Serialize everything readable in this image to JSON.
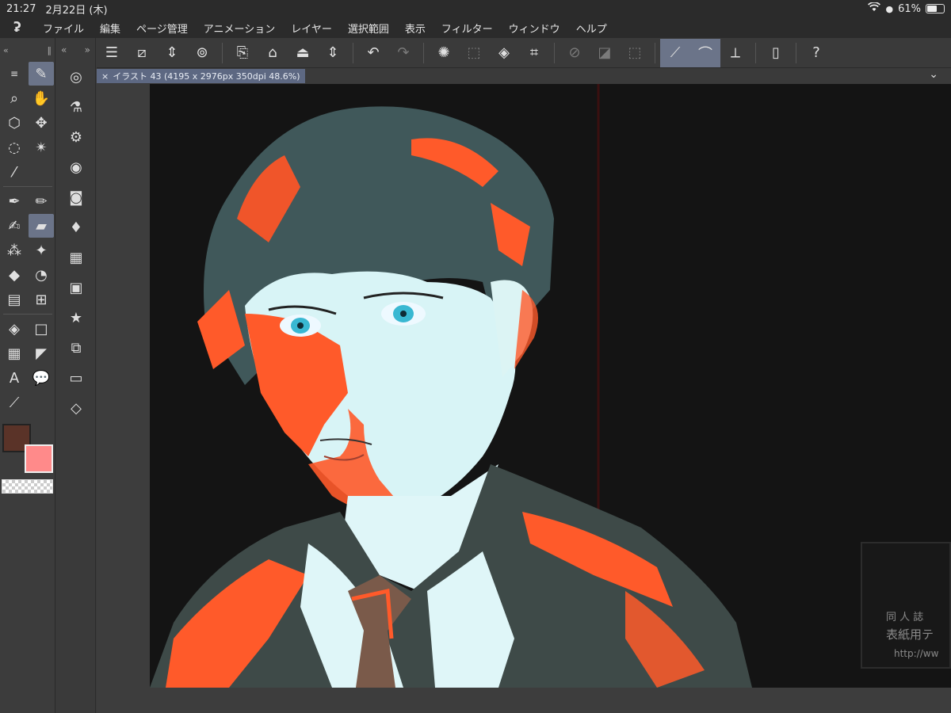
{
  "status_bar": {
    "time": "21:27",
    "date": "2月22日 (木)",
    "battery_pct": "61%",
    "battery_level": 0.61
  },
  "menu": {
    "logo_icon": "clip-studio-logo-icon",
    "items": [
      "ファイル",
      "編集",
      "ページ管理",
      "アニメーション",
      "レイヤー",
      "選択範囲",
      "表示",
      "フィルター",
      "ウィンドウ",
      "ヘルプ"
    ]
  },
  "document_tab": {
    "close": "×",
    "label": "イラスト 43 (4195 x 2976px 350dpi 48.6%)"
  },
  "colors": {
    "main": "#5a3328",
    "sub": "#ff8a8a",
    "active_tool_bg": "#6b7489",
    "tab_bg": "#5d6882"
  },
  "background_card": {
    "line1": "同 人 誌 ",
    "line2": "表紙用テ",
    "line3": "http://ww"
  }
}
